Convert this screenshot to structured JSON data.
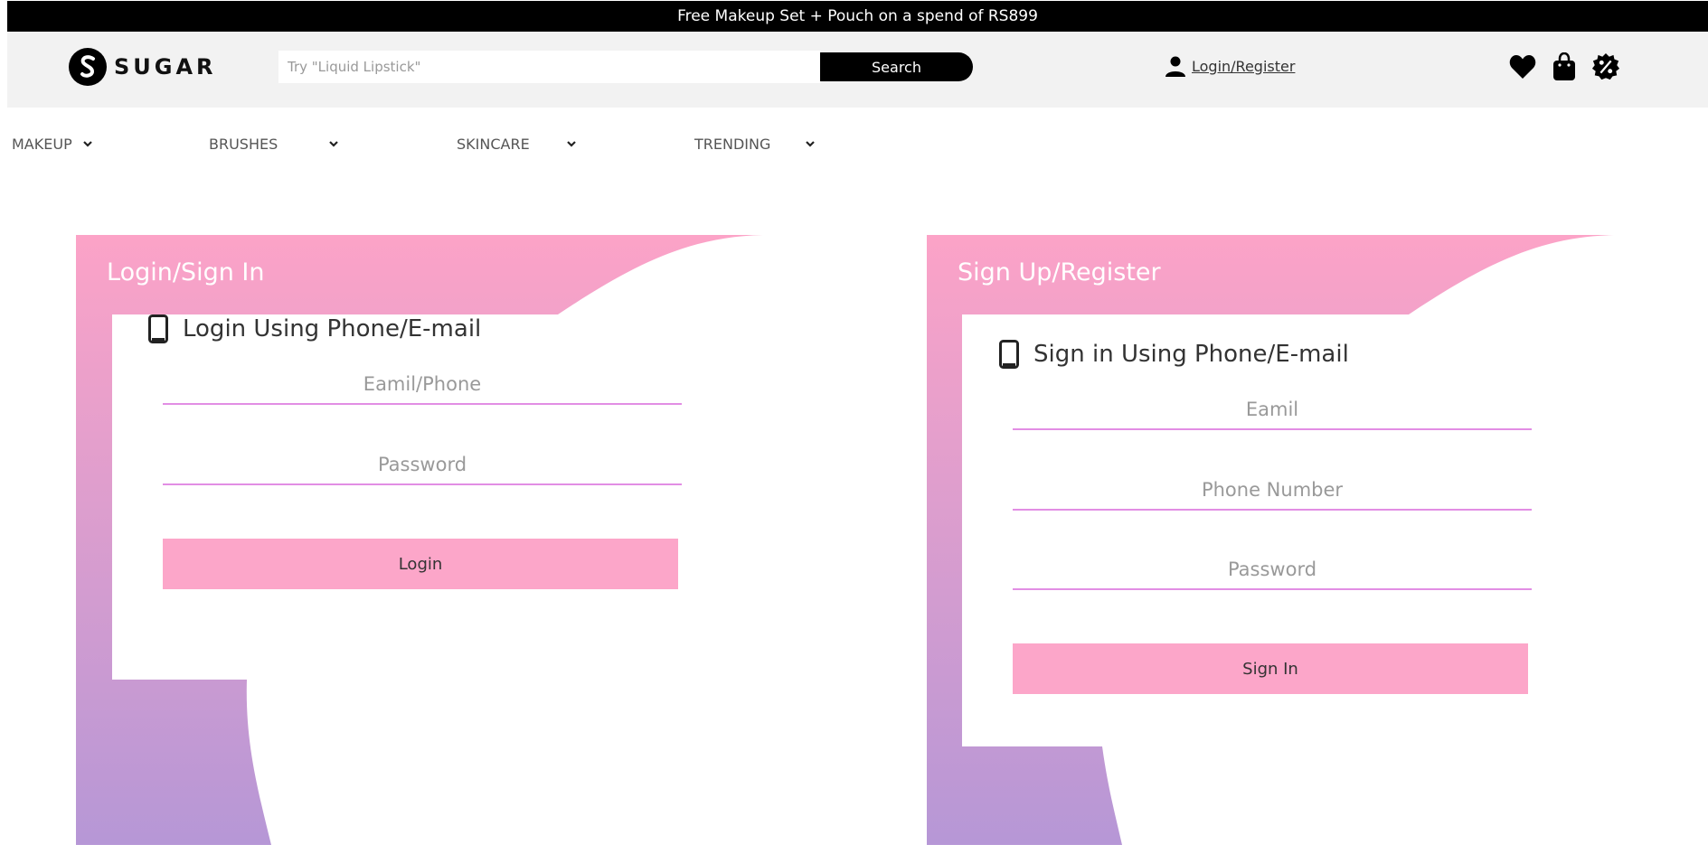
{
  "announcement": "Free Makeup Set + Pouch on a spend of RS899",
  "brand": {
    "name": "SUGAR",
    "logo_letter": "S"
  },
  "search": {
    "placeholder": "Try \"Liquid Lipstick\"",
    "button_label": "Search"
  },
  "account": {
    "label": "Login/Register",
    "icon": "user-icon"
  },
  "header_icons": [
    "heart-icon",
    "bag-icon",
    "offer-badge-icon"
  ],
  "categories": [
    {
      "label": "MAKEUP"
    },
    {
      "label": "BRUSHES"
    },
    {
      "label": "SKINCARE"
    },
    {
      "label": "TRENDING"
    }
  ],
  "colors": {
    "gradient_top": "#fca3c7",
    "gradient_bottom": "#b697d6",
    "underline": "#e28ee4",
    "button": "#fca6c9"
  },
  "login_panel": {
    "title": "Login/Sign In",
    "heading": "Login Using Phone/E-mail",
    "fields": [
      {
        "placeholder": "Eamil/Phone"
      },
      {
        "placeholder": "Password"
      }
    ],
    "button_label": "Login"
  },
  "signup_panel": {
    "title": "Sign Up/Register",
    "heading": "Sign in Using Phone/E-mail",
    "fields": [
      {
        "placeholder": "Eamil"
      },
      {
        "placeholder": "Phone Number"
      },
      {
        "placeholder": "Password"
      }
    ],
    "button_label": "Sign In"
  }
}
